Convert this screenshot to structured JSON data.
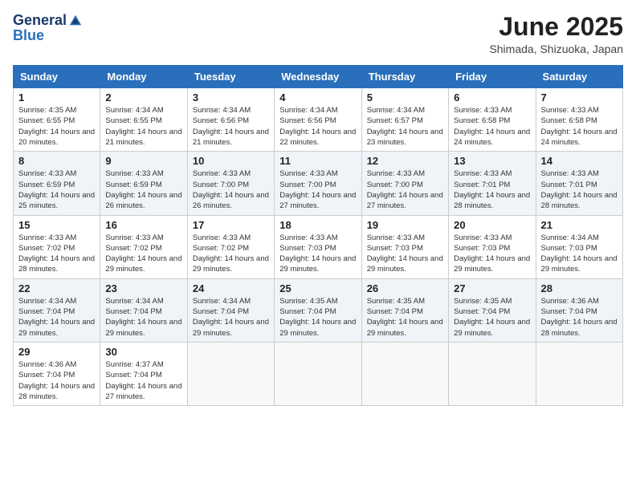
{
  "header": {
    "logo_line1": "General",
    "logo_line2": "Blue",
    "month": "June 2025",
    "location": "Shimada, Shizuoka, Japan"
  },
  "weekdays": [
    "Sunday",
    "Monday",
    "Tuesday",
    "Wednesday",
    "Thursday",
    "Friday",
    "Saturday"
  ],
  "weeks": [
    [
      {
        "day": "1",
        "sunrise": "Sunrise: 4:35 AM",
        "sunset": "Sunset: 6:55 PM",
        "daylight": "Daylight: 14 hours and 20 minutes."
      },
      {
        "day": "2",
        "sunrise": "Sunrise: 4:34 AM",
        "sunset": "Sunset: 6:55 PM",
        "daylight": "Daylight: 14 hours and 21 minutes."
      },
      {
        "day": "3",
        "sunrise": "Sunrise: 4:34 AM",
        "sunset": "Sunset: 6:56 PM",
        "daylight": "Daylight: 14 hours and 21 minutes."
      },
      {
        "day": "4",
        "sunrise": "Sunrise: 4:34 AM",
        "sunset": "Sunset: 6:56 PM",
        "daylight": "Daylight: 14 hours and 22 minutes."
      },
      {
        "day": "5",
        "sunrise": "Sunrise: 4:34 AM",
        "sunset": "Sunset: 6:57 PM",
        "daylight": "Daylight: 14 hours and 23 minutes."
      },
      {
        "day": "6",
        "sunrise": "Sunrise: 4:33 AM",
        "sunset": "Sunset: 6:58 PM",
        "daylight": "Daylight: 14 hours and 24 minutes."
      },
      {
        "day": "7",
        "sunrise": "Sunrise: 4:33 AM",
        "sunset": "Sunset: 6:58 PM",
        "daylight": "Daylight: 14 hours and 24 minutes."
      }
    ],
    [
      {
        "day": "8",
        "sunrise": "Sunrise: 4:33 AM",
        "sunset": "Sunset: 6:59 PM",
        "daylight": "Daylight: 14 hours and 25 minutes."
      },
      {
        "day": "9",
        "sunrise": "Sunrise: 4:33 AM",
        "sunset": "Sunset: 6:59 PM",
        "daylight": "Daylight: 14 hours and 26 minutes."
      },
      {
        "day": "10",
        "sunrise": "Sunrise: 4:33 AM",
        "sunset": "Sunset: 7:00 PM",
        "daylight": "Daylight: 14 hours and 26 minutes."
      },
      {
        "day": "11",
        "sunrise": "Sunrise: 4:33 AM",
        "sunset": "Sunset: 7:00 PM",
        "daylight": "Daylight: 14 hours and 27 minutes."
      },
      {
        "day": "12",
        "sunrise": "Sunrise: 4:33 AM",
        "sunset": "Sunset: 7:00 PM",
        "daylight": "Daylight: 14 hours and 27 minutes."
      },
      {
        "day": "13",
        "sunrise": "Sunrise: 4:33 AM",
        "sunset": "Sunset: 7:01 PM",
        "daylight": "Daylight: 14 hours and 28 minutes."
      },
      {
        "day": "14",
        "sunrise": "Sunrise: 4:33 AM",
        "sunset": "Sunset: 7:01 PM",
        "daylight": "Daylight: 14 hours and 28 minutes."
      }
    ],
    [
      {
        "day": "15",
        "sunrise": "Sunrise: 4:33 AM",
        "sunset": "Sunset: 7:02 PM",
        "daylight": "Daylight: 14 hours and 28 minutes."
      },
      {
        "day": "16",
        "sunrise": "Sunrise: 4:33 AM",
        "sunset": "Sunset: 7:02 PM",
        "daylight": "Daylight: 14 hours and 29 minutes."
      },
      {
        "day": "17",
        "sunrise": "Sunrise: 4:33 AM",
        "sunset": "Sunset: 7:02 PM",
        "daylight": "Daylight: 14 hours and 29 minutes."
      },
      {
        "day": "18",
        "sunrise": "Sunrise: 4:33 AM",
        "sunset": "Sunset: 7:03 PM",
        "daylight": "Daylight: 14 hours and 29 minutes."
      },
      {
        "day": "19",
        "sunrise": "Sunrise: 4:33 AM",
        "sunset": "Sunset: 7:03 PM",
        "daylight": "Daylight: 14 hours and 29 minutes."
      },
      {
        "day": "20",
        "sunrise": "Sunrise: 4:33 AM",
        "sunset": "Sunset: 7:03 PM",
        "daylight": "Daylight: 14 hours and 29 minutes."
      },
      {
        "day": "21",
        "sunrise": "Sunrise: 4:34 AM",
        "sunset": "Sunset: 7:03 PM",
        "daylight": "Daylight: 14 hours and 29 minutes."
      }
    ],
    [
      {
        "day": "22",
        "sunrise": "Sunrise: 4:34 AM",
        "sunset": "Sunset: 7:04 PM",
        "daylight": "Daylight: 14 hours and 29 minutes."
      },
      {
        "day": "23",
        "sunrise": "Sunrise: 4:34 AM",
        "sunset": "Sunset: 7:04 PM",
        "daylight": "Daylight: 14 hours and 29 minutes."
      },
      {
        "day": "24",
        "sunrise": "Sunrise: 4:34 AM",
        "sunset": "Sunset: 7:04 PM",
        "daylight": "Daylight: 14 hours and 29 minutes."
      },
      {
        "day": "25",
        "sunrise": "Sunrise: 4:35 AM",
        "sunset": "Sunset: 7:04 PM",
        "daylight": "Daylight: 14 hours and 29 minutes."
      },
      {
        "day": "26",
        "sunrise": "Sunrise: 4:35 AM",
        "sunset": "Sunset: 7:04 PM",
        "daylight": "Daylight: 14 hours and 29 minutes."
      },
      {
        "day": "27",
        "sunrise": "Sunrise: 4:35 AM",
        "sunset": "Sunset: 7:04 PM",
        "daylight": "Daylight: 14 hours and 29 minutes."
      },
      {
        "day": "28",
        "sunrise": "Sunrise: 4:36 AM",
        "sunset": "Sunset: 7:04 PM",
        "daylight": "Daylight: 14 hours and 28 minutes."
      }
    ],
    [
      {
        "day": "29",
        "sunrise": "Sunrise: 4:36 AM",
        "sunset": "Sunset: 7:04 PM",
        "daylight": "Daylight: 14 hours and 28 minutes."
      },
      {
        "day": "30",
        "sunrise": "Sunrise: 4:37 AM",
        "sunset": "Sunset: 7:04 PM",
        "daylight": "Daylight: 14 hours and 27 minutes."
      },
      null,
      null,
      null,
      null,
      null
    ]
  ]
}
